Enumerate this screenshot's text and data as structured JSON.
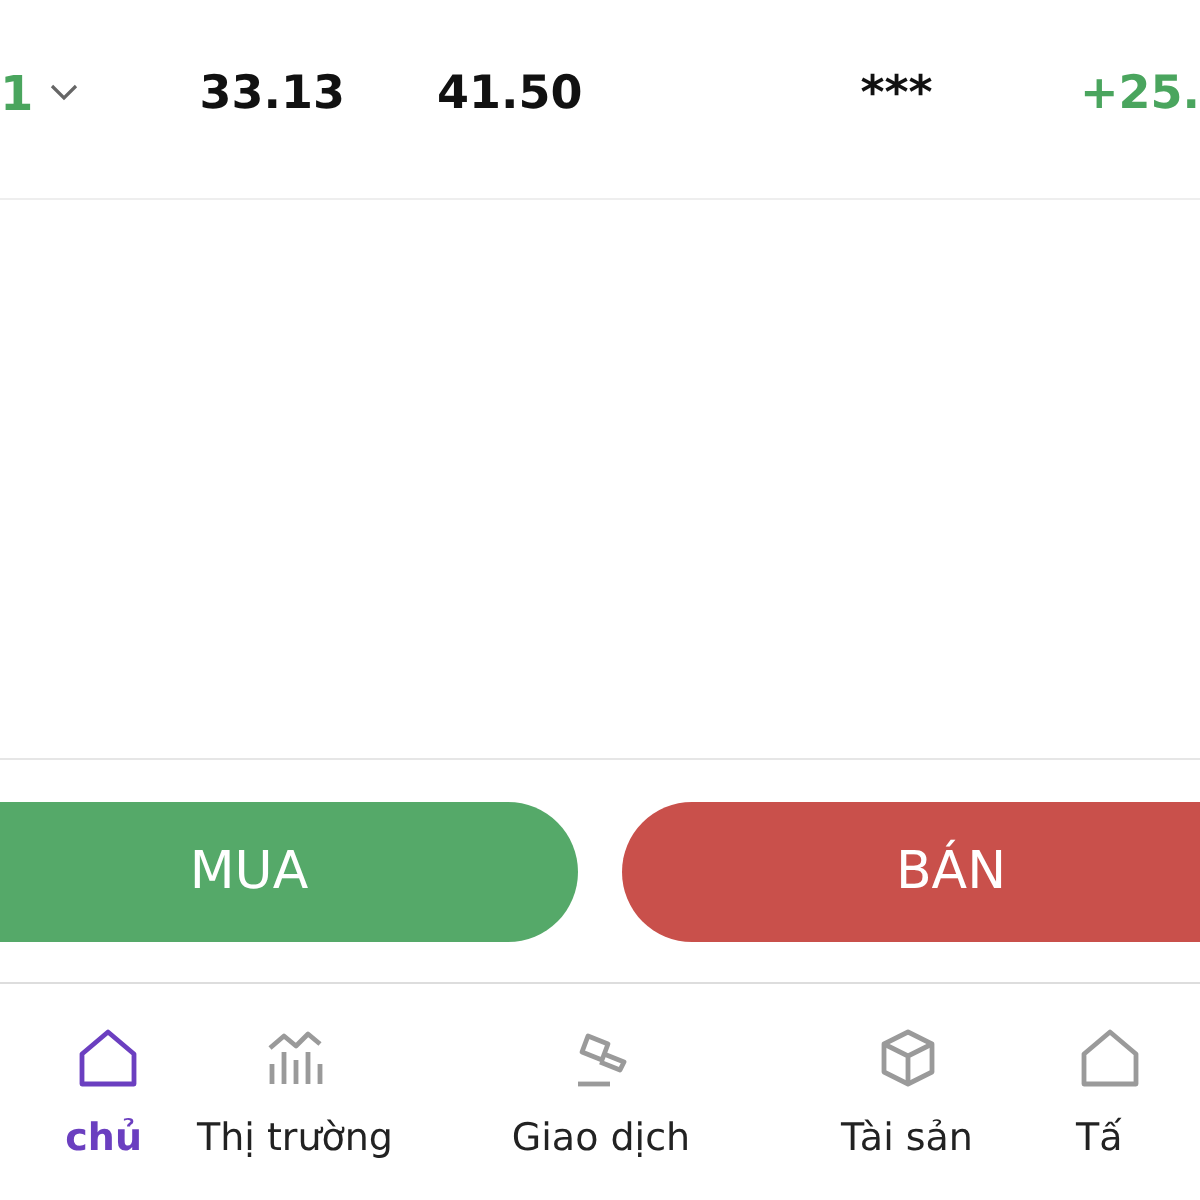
{
  "quote_row": {
    "symbol": "1",
    "bid": "33.13",
    "ask": "41.50",
    "masked": "***",
    "change": "+25."
  },
  "buttons": [
    {
      "label": "MUA",
      "kind": "buy"
    },
    {
      "label": "BÁN",
      "kind": "sell"
    }
  ],
  "nav": [
    {
      "label": "chủ",
      "selected": true
    },
    {
      "label": "Thị trường",
      "selected": false
    },
    {
      "label": "Giao dịch",
      "selected": false
    },
    {
      "label": "Tài sản",
      "selected": false
    },
    {
      "label": "Tấ",
      "selected": false
    }
  ]
}
